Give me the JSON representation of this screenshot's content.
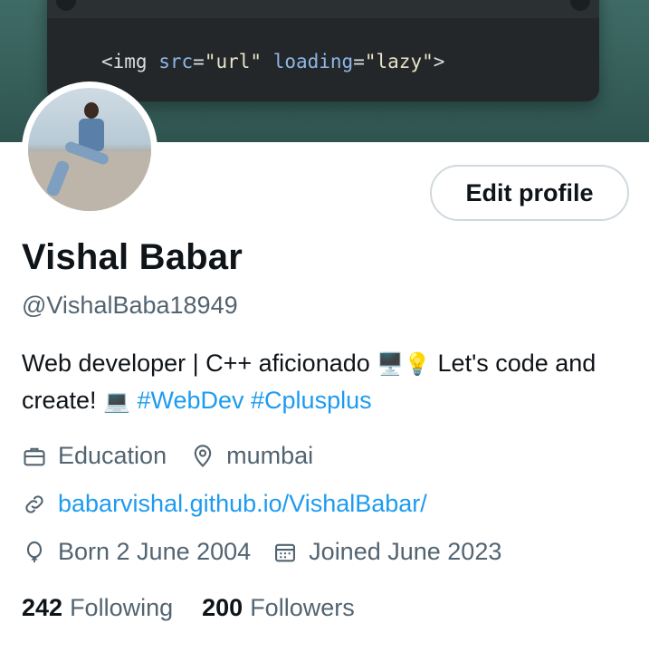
{
  "banner": {
    "code": {
      "tag_open": "<img",
      "attr1": "src",
      "val1": "\"url\"",
      "attr2": "loading",
      "val2": "\"lazy\"",
      "tag_close": ">"
    }
  },
  "profile": {
    "edit_button": "Edit profile",
    "name": "Vishal Babar",
    "handle": "@VishalBaba18949",
    "bio": {
      "text1": "Web developer | C++ aficionado ",
      "emoji1": "🖥️💡",
      "text2": " Let's code and create! ",
      "emoji2": "💻",
      "hashtag1": "#WebDev",
      "hashtag2": "#Cplusplus"
    },
    "category": "Education",
    "location": "mumbai",
    "website": "babarvishal.github.io/VishalBabar/",
    "born": "Born 2 June 2004",
    "joined": "Joined June 2023",
    "following_count": "242",
    "following_label": "Following",
    "followers_count": "200",
    "followers_label": "Followers"
  },
  "icons": {
    "category": "briefcase-icon",
    "location": "location-pin-icon",
    "website": "link-icon",
    "born": "balloon-icon",
    "joined": "calendar-icon"
  },
  "colors": {
    "accent": "#1d9bf0",
    "secondary_text": "#536471",
    "primary_text": "#0f1419",
    "banner": "#3f6b66"
  }
}
